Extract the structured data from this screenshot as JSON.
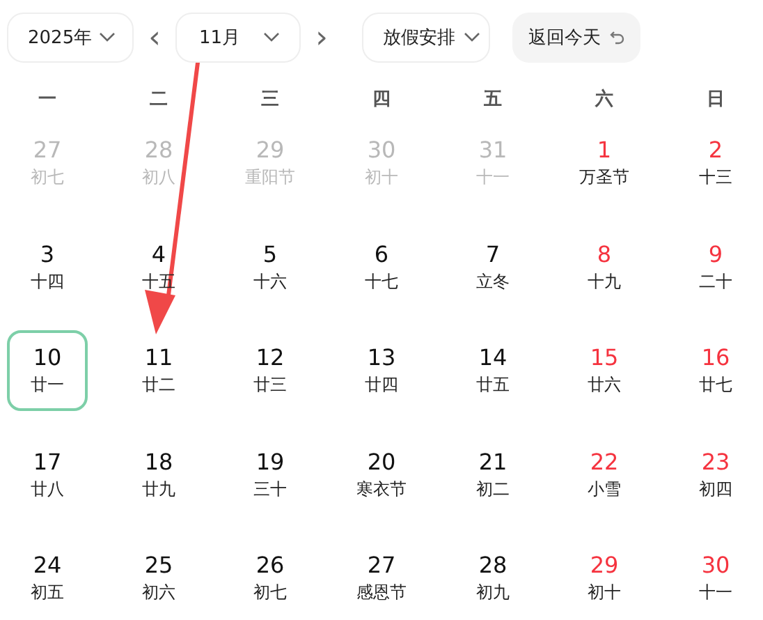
{
  "toolbar": {
    "year": "2025年",
    "month": "11月",
    "prev": "‹",
    "next": "›",
    "holiday": "放假安排",
    "today_button": "返回今天"
  },
  "weekdays": [
    "一",
    "二",
    "三",
    "四",
    "五",
    "六",
    "日"
  ],
  "weeks": [
    [
      {
        "day": "27",
        "lunar": "初七",
        "kind": "other",
        "today": false
      },
      {
        "day": "28",
        "lunar": "初八",
        "kind": "other",
        "today": false
      },
      {
        "day": "29",
        "lunar": "重阳节",
        "kind": "other",
        "today": false
      },
      {
        "day": "30",
        "lunar": "初十",
        "kind": "other",
        "today": false
      },
      {
        "day": "31",
        "lunar": "十一",
        "kind": "other",
        "today": false
      },
      {
        "day": "1",
        "lunar": "万圣节",
        "kind": "weekend",
        "today": false
      },
      {
        "day": "2",
        "lunar": "十三",
        "kind": "weekend",
        "today": false
      }
    ],
    [
      {
        "day": "3",
        "lunar": "十四",
        "kind": "weekday",
        "today": false
      },
      {
        "day": "4",
        "lunar": "十五",
        "kind": "weekday",
        "today": false
      },
      {
        "day": "5",
        "lunar": "十六",
        "kind": "weekday",
        "today": false
      },
      {
        "day": "6",
        "lunar": "十七",
        "kind": "weekday",
        "today": false
      },
      {
        "day": "7",
        "lunar": "立冬",
        "kind": "weekday",
        "today": false
      },
      {
        "day": "8",
        "lunar": "十九",
        "kind": "weekend",
        "today": false
      },
      {
        "day": "9",
        "lunar": "二十",
        "kind": "weekend",
        "today": false
      }
    ],
    [
      {
        "day": "10",
        "lunar": "廿一",
        "kind": "weekday",
        "today": true
      },
      {
        "day": "11",
        "lunar": "廿二",
        "kind": "weekday",
        "today": false
      },
      {
        "day": "12",
        "lunar": "廿三",
        "kind": "weekday",
        "today": false
      },
      {
        "day": "13",
        "lunar": "廿四",
        "kind": "weekday",
        "today": false
      },
      {
        "day": "14",
        "lunar": "廿五",
        "kind": "weekday",
        "today": false
      },
      {
        "day": "15",
        "lunar": "廿六",
        "kind": "weekend",
        "today": false
      },
      {
        "day": "16",
        "lunar": "廿七",
        "kind": "weekend",
        "today": false
      }
    ],
    [
      {
        "day": "17",
        "lunar": "廿八",
        "kind": "weekday",
        "today": false
      },
      {
        "day": "18",
        "lunar": "廿九",
        "kind": "weekday",
        "today": false
      },
      {
        "day": "19",
        "lunar": "三十",
        "kind": "weekday",
        "today": false
      },
      {
        "day": "20",
        "lunar": "寒衣节",
        "kind": "weekday",
        "today": false
      },
      {
        "day": "21",
        "lunar": "初二",
        "kind": "weekday",
        "today": false
      },
      {
        "day": "22",
        "lunar": "小雪",
        "kind": "weekend",
        "today": false
      },
      {
        "day": "23",
        "lunar": "初四",
        "kind": "weekend",
        "today": false
      }
    ],
    [
      {
        "day": "24",
        "lunar": "初五",
        "kind": "weekday",
        "today": false
      },
      {
        "day": "25",
        "lunar": "初六",
        "kind": "weekday",
        "today": false
      },
      {
        "day": "26",
        "lunar": "初七",
        "kind": "weekday",
        "today": false
      },
      {
        "day": "27",
        "lunar": "感恩节",
        "kind": "weekday",
        "today": false
      },
      {
        "day": "28",
        "lunar": "初九",
        "kind": "weekday",
        "today": false
      },
      {
        "day": "29",
        "lunar": "初十",
        "kind": "weekend",
        "today": false
      },
      {
        "day": "30",
        "lunar": "十一",
        "kind": "weekend",
        "today": false
      }
    ]
  ]
}
